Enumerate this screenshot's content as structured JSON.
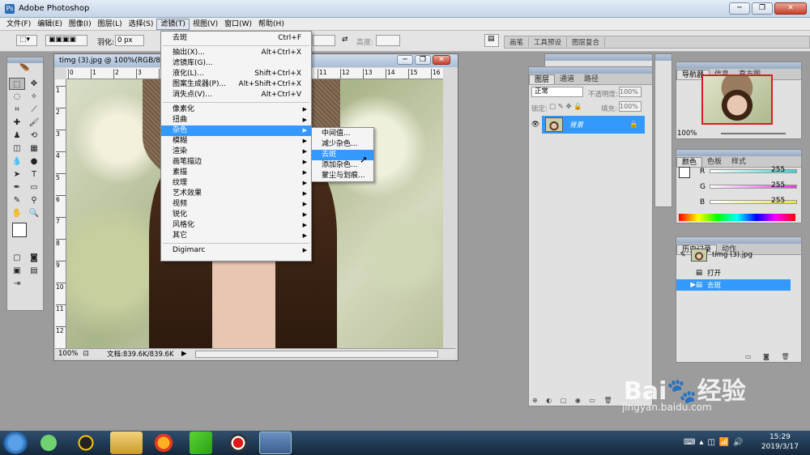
{
  "app": {
    "title": "Adobe Photoshop",
    "logo_glyph": "Ps"
  },
  "window_buttons": {
    "minimize": "─",
    "restore": "❐",
    "close": "✕"
  },
  "menubar": [
    "文件(F)",
    "编辑(E)",
    "图像(I)",
    "图层(L)",
    "选择(S)",
    "滤镜(T)",
    "视图(V)",
    "窗口(W)",
    "帮助(H)"
  ],
  "options": {
    "feather_label": "羽化:",
    "feather_value": "0 px",
    "height_label": "高度:"
  },
  "palette_well": [
    "画笔",
    "工具预设",
    "图层复合"
  ],
  "document": {
    "title": "timg (3).jpg @ 100%(RGB/8)",
    "zoom": "100%",
    "status": "文档:839.6K/839.6K",
    "ruler_h": [
      "0",
      "1",
      "2",
      "3",
      "4",
      "5",
      "6",
      "7",
      "8",
      "9",
      "10",
      "11",
      "12",
      "13",
      "14",
      "15",
      "16"
    ],
    "ruler_v": [
      "1",
      "2",
      "3",
      "4",
      "5",
      "6",
      "7",
      "8",
      "9",
      "10",
      "11",
      "12"
    ]
  },
  "filter_menu": {
    "top": {
      "label": "去斑",
      "shortcut": "Ctrl+F"
    },
    "group1": [
      {
        "label": "抽出(X)...",
        "shortcut": "Alt+Ctrl+X"
      },
      {
        "label": "滤镜库(G)...",
        "shortcut": ""
      },
      {
        "label": "液化(L)...",
        "shortcut": "Shift+Ctrl+X"
      },
      {
        "label": "图案生成器(P)...",
        "shortcut": "Alt+Shift+Ctrl+X"
      },
      {
        "label": "消失点(V)...",
        "shortcut": "Alt+Ctrl+V"
      }
    ],
    "group2": [
      "像素化",
      "扭曲",
      "杂色",
      "模糊",
      "渲染",
      "画笔描边",
      "素描",
      "纹理",
      "艺术效果",
      "视频",
      "锐化",
      "风格化",
      "其它"
    ],
    "group3": [
      "Digimarc"
    ],
    "highlighted": "杂色"
  },
  "noise_submenu": {
    "items": [
      "中间值...",
      "减少杂色...",
      "去斑",
      "添加杂色...",
      "蒙尘与划痕..."
    ],
    "highlighted": "去斑"
  },
  "layers_panel": {
    "tabs": [
      "图层",
      "通道",
      "路径"
    ],
    "blend_mode": "正常",
    "opacity_label": "不透明度:",
    "opacity": "100%",
    "lock_label": "锁定:",
    "fill_label": "填充:",
    "fill": "100%",
    "layer_name": "背景"
  },
  "navigator": {
    "tabs": [
      "导航器",
      "信息",
      "直方图"
    ],
    "zoom": "100%"
  },
  "color_panel": {
    "tabs": [
      "颜色",
      "色板",
      "样式"
    ],
    "r_label": "R",
    "g_label": "G",
    "b_label": "B",
    "r": "255",
    "g": "255",
    "b": "255",
    "colors": {
      "r": "#3fd0d0",
      "g": "#e040d8",
      "b": "#e8e640"
    }
  },
  "history_panel": {
    "tabs": [
      "历史记录",
      "动作"
    ],
    "snapshot": "timg (3).jpg",
    "steps": [
      "打开",
      "去斑"
    ],
    "selected": "去斑"
  },
  "watermark": {
    "brand": "Bai🐾经验",
    "url": "jingyan.baidu.com"
  },
  "taskbar": {
    "time": "15:29",
    "date": "2019/3/17"
  }
}
